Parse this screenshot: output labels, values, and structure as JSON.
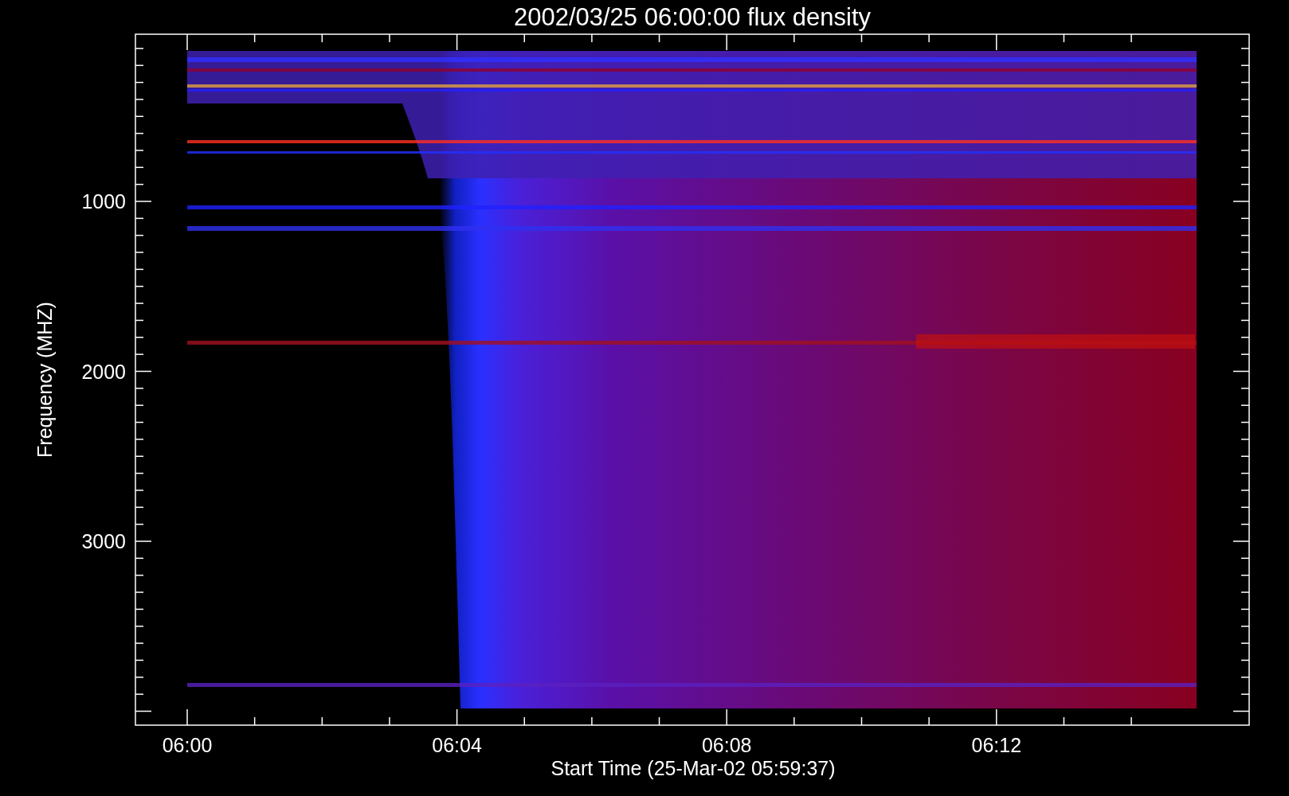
{
  "title": "2002/03/25 06:00:00 flux density",
  "x_axis": {
    "label": "Start Time (25-Mar-02 05:59:37)",
    "ticks": [
      "06:00",
      "06:04",
      "06:08",
      "06:12"
    ]
  },
  "y_axis": {
    "label": "Frequency (MHZ)",
    "ticks": [
      "1000",
      "2000",
      "3000"
    ]
  }
}
